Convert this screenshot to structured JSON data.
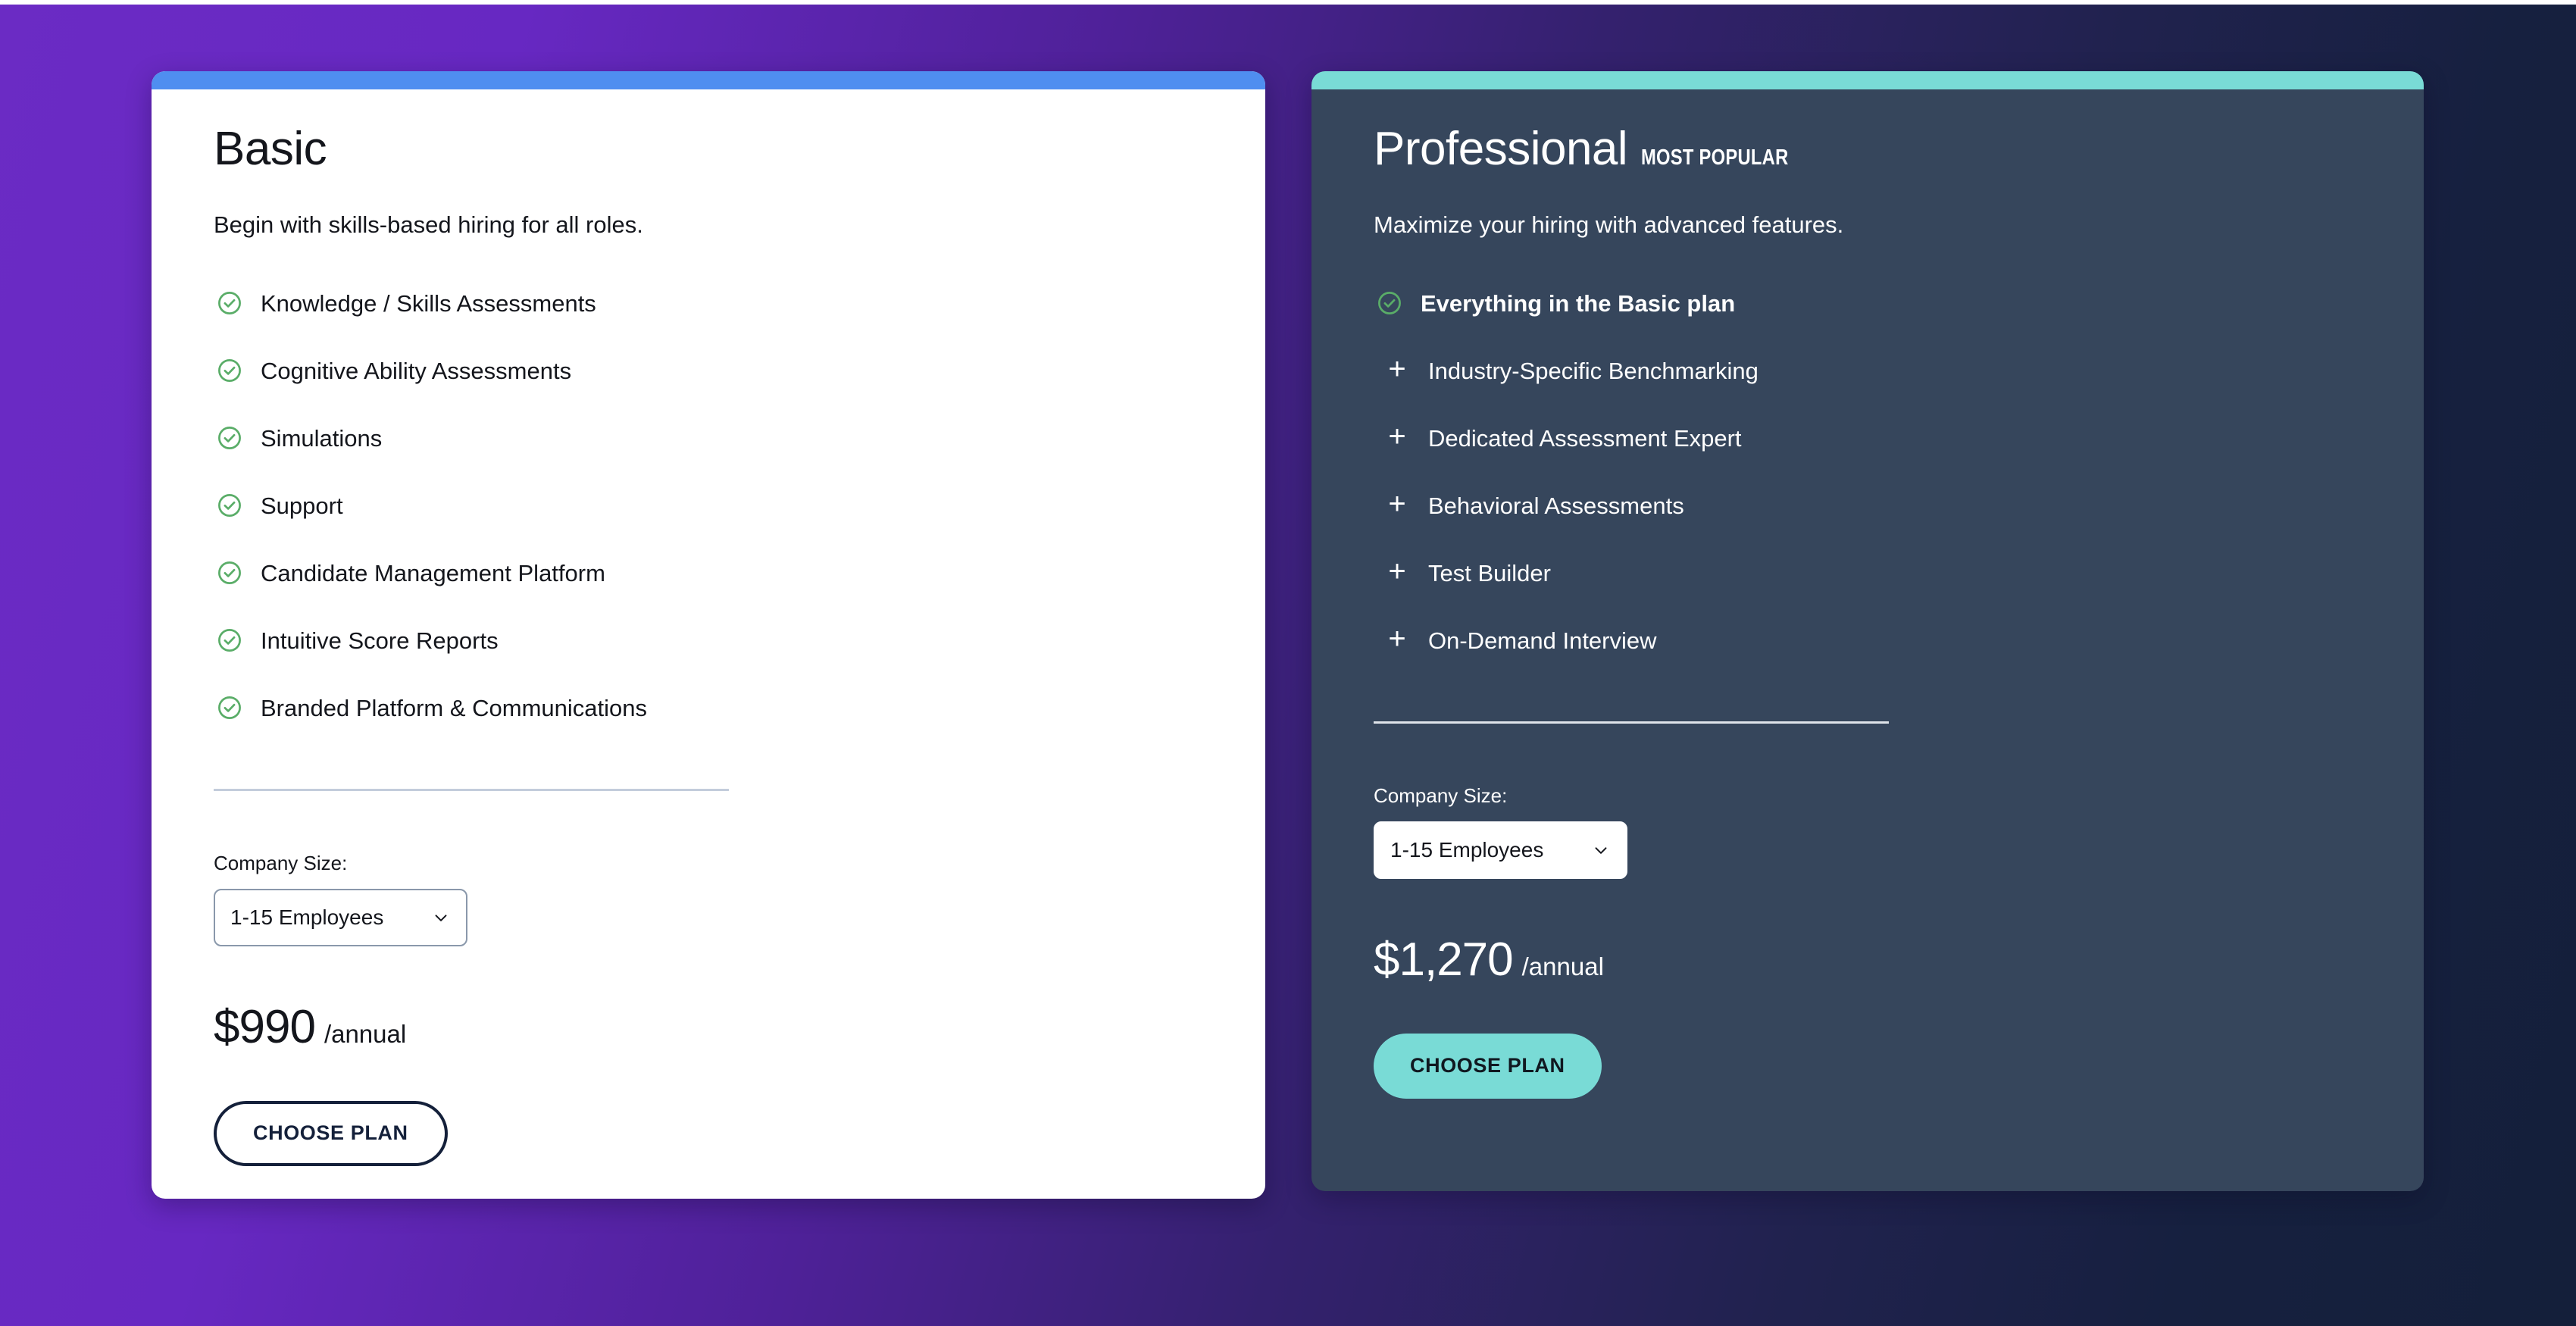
{
  "theme": {
    "background_gradient_from": "#6b2bc4",
    "background_gradient_to": "#141f3a",
    "basic_accent": "#4f8ef0",
    "professional_accent": "#79dbd6",
    "professional_card_bg": "#36465c",
    "check_icon_color": "#5aad68",
    "cta_outline_color": "#14203a"
  },
  "plans": [
    {
      "id": "basic",
      "title": "Basic",
      "badge": "",
      "subtitle": "Begin with skills-based hiring for all roles.",
      "accent_color": "#4f8ef0",
      "features": [
        {
          "marker": "check-icon",
          "label": "Knowledge / Skills Assessments",
          "bold": false
        },
        {
          "marker": "check-icon",
          "label": "Cognitive Ability Assessments",
          "bold": false
        },
        {
          "marker": "check-icon",
          "label": "Simulations",
          "bold": false
        },
        {
          "marker": "check-icon",
          "label": "Support",
          "bold": false
        },
        {
          "marker": "check-icon",
          "label": "Candidate Management Platform",
          "bold": false
        },
        {
          "marker": "check-icon",
          "label": "Intuitive Score Reports",
          "bold": false
        },
        {
          "marker": "check-icon",
          "label": "Branded Platform & Communications",
          "bold": false
        }
      ],
      "company_size": {
        "label": "Company Size:",
        "value": "1-15 Employees",
        "options": [
          "1-15 Employees"
        ]
      },
      "price": {
        "amount": "$990",
        "period": "/annual"
      },
      "cta": {
        "label": "CHOOSE PLAN",
        "style": "outline"
      }
    },
    {
      "id": "professional",
      "title": "Professional",
      "badge": "MOST POPULAR",
      "subtitle": "Maximize your hiring with advanced features.",
      "accent_color": "#79dbd6",
      "features": [
        {
          "marker": "check-icon",
          "label": "Everything in the Basic plan",
          "bold": true
        },
        {
          "marker": "plus-icon",
          "label": "Industry-Specific Benchmarking",
          "bold": false
        },
        {
          "marker": "plus-icon",
          "label": "Dedicated Assessment Expert",
          "bold": false
        },
        {
          "marker": "plus-icon",
          "label": "Behavioral Assessments",
          "bold": false
        },
        {
          "marker": "plus-icon",
          "label": "Test Builder",
          "bold": false
        },
        {
          "marker": "plus-icon",
          "label": "On-Demand Interview",
          "bold": false
        }
      ],
      "company_size": {
        "label": "Company Size:",
        "value": "1-15 Employees",
        "options": [
          "1-15 Employees"
        ]
      },
      "price": {
        "amount": "$1,270",
        "period": "/annual"
      },
      "cta": {
        "label": "CHOOSE PLAN",
        "style": "filled"
      }
    }
  ]
}
